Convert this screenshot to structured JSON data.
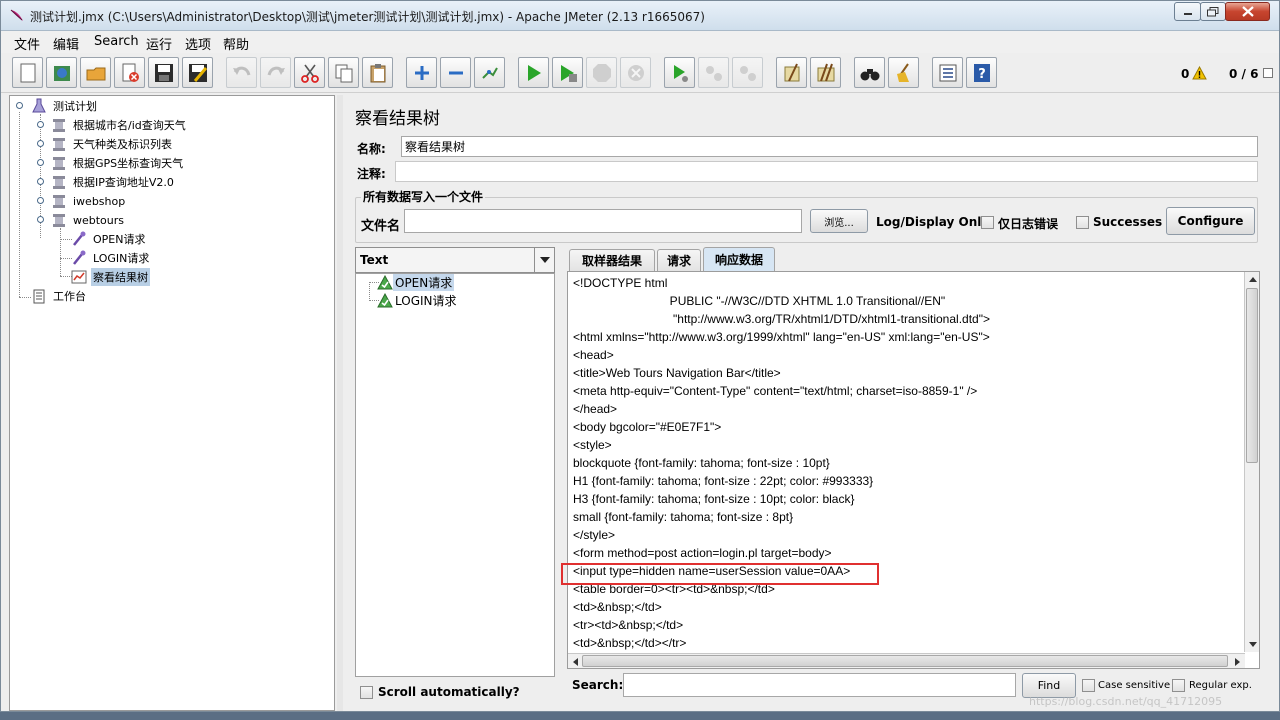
{
  "window": {
    "title": "测试计划.jmx (C:\\Users\\Administrator\\Desktop\\测试\\jmeter测试计划\\测试计划.jmx) - Apache JMeter (2.13 r1665067)"
  },
  "menu": [
    "文件",
    "编辑",
    "Search",
    "运行",
    "选项",
    "帮助"
  ],
  "toolbar": {
    "error_count": "0",
    "thread_count": "0 / 6",
    "buttons": [
      "new-icon",
      "templates-icon",
      "open-icon",
      "close-file-icon",
      "save-icon",
      "save-as-icon",
      "undo-icon",
      "redo-icon",
      "cut-icon",
      "copy-icon",
      "paste-icon",
      "expand-icon",
      "collapse-icon",
      "toggle-icon",
      "start-icon",
      "start-no-pause-icon",
      "stop-icon",
      "shutdown-icon",
      "remote-start-icon",
      "remote-stop-icon",
      "remote-shutdown-icon",
      "clear-icon",
      "clear-all-icon",
      "search-icon",
      "reset-search-icon",
      "function-helper-icon",
      "help-icon"
    ]
  },
  "tree": {
    "root": "测试计划",
    "groups": [
      "根据城市名/id查询天气",
      "天气种类及标识列表",
      "根据GPS坐标查询天气",
      "根据IP查询地址V2.0",
      "iwebshop",
      "webtours"
    ],
    "children": [
      "OPEN请求",
      "LOGIN请求",
      "察看结果树"
    ],
    "workbench": "工作台"
  },
  "panel": {
    "title": "察看结果树",
    "name_label": "名称:",
    "name_value": "察看结果树",
    "comment_label": "注释:",
    "comment_value": "",
    "file_group_title": "所有数据写入一个文件",
    "filename_label": "文件名",
    "filename_value": "",
    "browse_button": "浏览...",
    "log_display_label": "Log/Display Only:",
    "errors_only_label": "仅日志错误",
    "successes_label": "Successes",
    "configure_button": "Configure"
  },
  "results": {
    "renderer": "Text",
    "samples": [
      "OPEN请求",
      "LOGIN请求"
    ],
    "scroll_auto_label": "Scroll automatically?"
  },
  "tabs": [
    "取样器结果",
    "请求",
    "响应数据"
  ],
  "response_lines": [
    "<!DOCTYPE html",
    "                             PUBLIC \"-//W3C//DTD XHTML 1.0 Transitional//EN\"",
    "                              \"http://www.w3.org/TR/xhtml1/DTD/xhtml1-transitional.dtd\">",
    "<html xmlns=\"http://www.w3.org/1999/xhtml\" lang=\"en-US\" xml:lang=\"en-US\">",
    "<head>",
    "<title>Web Tours Navigation Bar</title>",
    "<meta http-equiv=\"Content-Type\" content=\"text/html; charset=iso-8859-1\" />",
    "</head>",
    "<body bgcolor=\"#E0E7F1\">",
    "<style>",
    "blockquote {font-family: tahoma; font-size : 10pt}",
    "H1 {font-family: tahoma; font-size : 22pt; color: #993333}",
    "H3 {font-family: tahoma; font-size : 10pt; color: black}",
    "small {font-family: tahoma; font-size : 8pt}",
    "</style>",
    "<form method=post action=login.pl target=body>",
    "<input type=hidden name=userSession value=0AA>",
    "<table border=0><tr><td>&nbsp;</td>",
    "<td>&nbsp;</td>",
    "<tr><td>&nbsp;</td>",
    "<td>&nbsp;</td></tr>"
  ],
  "search": {
    "label": "Search:",
    "value": "",
    "find_button": "Find",
    "case_label": "Case sensitive",
    "regex_label": "Regular exp."
  },
  "watermark": "https://blog.csdn.net/qq_41712095",
  "colors": {
    "highlight": "#e03030",
    "selection": "#b8cfe5",
    "tab_active": "#d7e6f4"
  }
}
